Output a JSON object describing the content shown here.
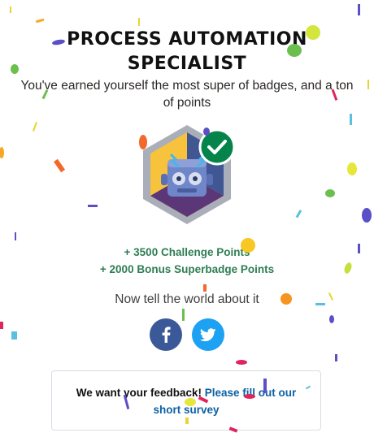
{
  "badge": {
    "title_line1": "PROCESS AUTOMATION",
    "title_line2": "SPECIALIST",
    "subtitle": "You've earned yourself the most super of badges, and a ton of points",
    "image_icon": "robot-badge-icon",
    "completed_icon": "checkmark-icon"
  },
  "points": {
    "challenge": "+ 3500 Challenge Points",
    "bonus": "+ 2000 Bonus Superbadge Points"
  },
  "share": {
    "prompt": "Now tell the world about it",
    "facebook_icon": "facebook-icon",
    "twitter_icon": "twitter-icon"
  },
  "feedback": {
    "text": "We want your feedback!",
    "link_text": "Please fill out our short survey"
  },
  "colors": {
    "title": "#111111",
    "points": "#2e7d53",
    "facebook": "#3b5998",
    "twitter": "#1da1f2",
    "checkmark": "#04844b",
    "link": "#0b61a4"
  }
}
